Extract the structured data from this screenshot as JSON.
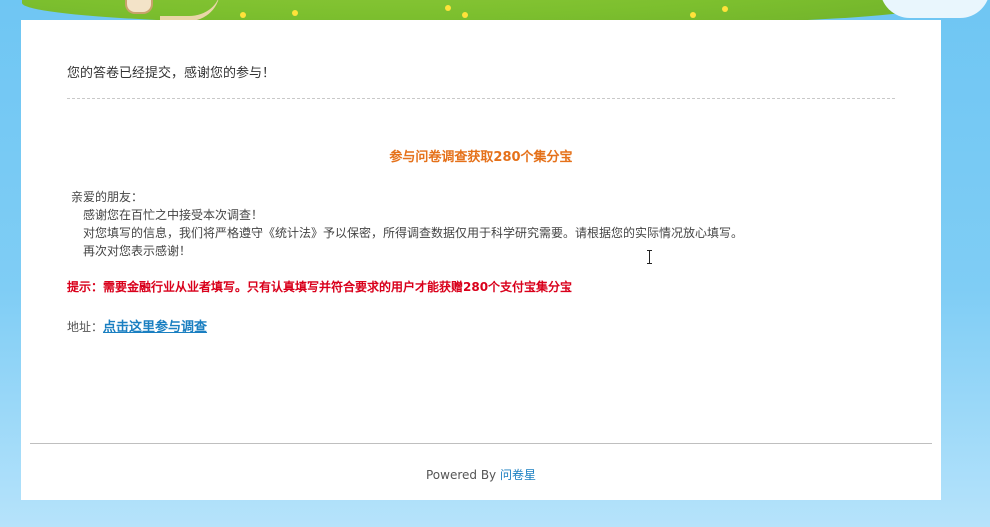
{
  "page": {
    "submitted_message": "您的答卷已经提交，感谢您的参与！",
    "survey_title": "参与问卷调查获取280个集分宝",
    "letter": {
      "greeting": "亲爱的朋友：",
      "line1": "感谢您在百忙之中接受本次调查！",
      "line2": "对您填写的信息，我们将严格遵守《统计法》予以保密，所得调查数据仅用于科学研究需要。请根据您的实际情况放心填写。",
      "line3": "再次对您表示感谢！"
    },
    "notice": "提示：需要金融行业从业者填写。只有认真填写并符合要求的用户才能获赠280个支付宝集分宝",
    "address_label": "地址：",
    "address_link": "点击这里参与调查"
  },
  "footer": {
    "powered_by": "Powered By",
    "brand": "问卷星"
  },
  "colors": {
    "title_orange": "#e5711a",
    "notice_red": "#d9001b",
    "link_blue": "#1a7fc1"
  }
}
